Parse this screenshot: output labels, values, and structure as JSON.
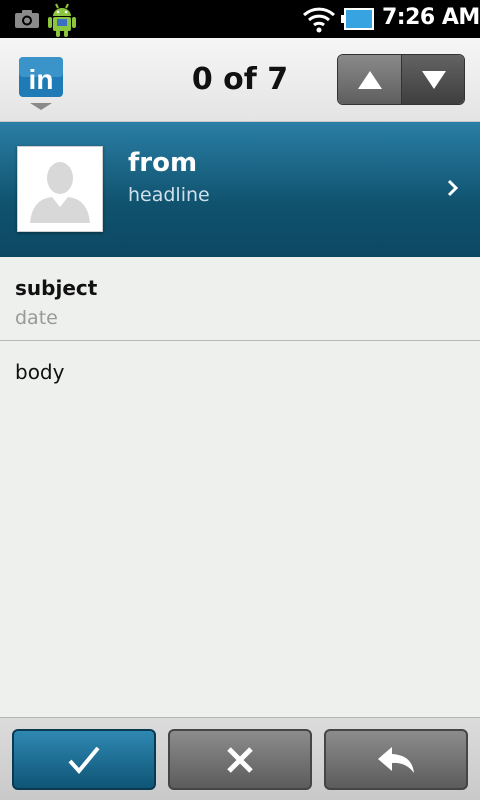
{
  "status_bar": {
    "time": "7:26 AM",
    "icons": [
      "camera-icon",
      "android-icon",
      "wifi-icon",
      "battery-icon"
    ]
  },
  "title_bar": {
    "logo_text": "in",
    "counter": "0 of 7",
    "nav": {
      "up": "arrow-up-icon",
      "down": "arrow-down-icon"
    }
  },
  "message": {
    "from": "from",
    "headline": "headline",
    "subject": "subject",
    "date": "date",
    "body": "body"
  },
  "toolbar": {
    "buttons": [
      "check-icon",
      "close-icon",
      "reply-icon"
    ]
  },
  "colors": {
    "brand_blue": "#10536f",
    "accent_blue": "#2a7ea5",
    "logo_blue": "#1f7bb6"
  }
}
